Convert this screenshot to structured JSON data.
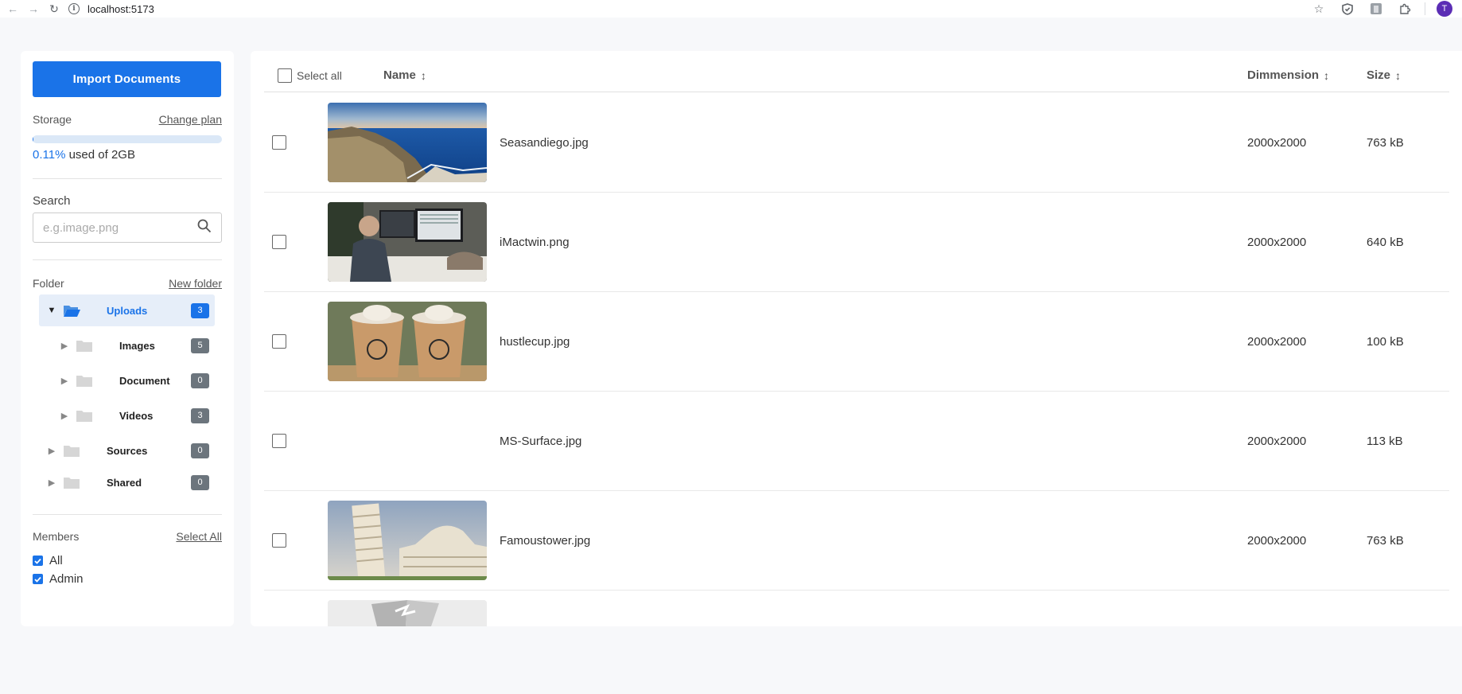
{
  "browser": {
    "url": "localhost:5173",
    "profile_initial": "T"
  },
  "sidebar": {
    "import_label": "Import Documents",
    "storage": {
      "label": "Storage",
      "change_plan": "Change plan",
      "percent_text": "0.11%",
      "percent_value": 0.11,
      "used_of": "used of 2GB"
    },
    "search": {
      "label": "Search",
      "placeholder": "e.g.image.png"
    },
    "folder": {
      "label": "Folder",
      "new_folder": "New folder",
      "items": [
        {
          "name": "Uploads",
          "count": "3",
          "expanded": true,
          "selected": true
        },
        {
          "name": "Images",
          "count": "5"
        },
        {
          "name": "Document",
          "count": "0"
        },
        {
          "name": "Videos",
          "count": "3"
        },
        {
          "name": "Sources",
          "count": "0"
        },
        {
          "name": "Shared",
          "count": "0"
        }
      ]
    },
    "members": {
      "label": "Members",
      "select_all": "Select All",
      "items": [
        {
          "name": "All",
          "checked": true
        },
        {
          "name": "Admin",
          "checked": true
        }
      ]
    }
  },
  "table": {
    "select_all": "Select all",
    "columns": {
      "name": "Name",
      "dimension": "Dimmension",
      "size": "Size",
      "sort_icon": "↕"
    },
    "rows": [
      {
        "name": "Seasandiego.jpg",
        "dimension": "2000x2000",
        "size": "763 kB",
        "thumb": "coast-cliff-ocean"
      },
      {
        "name": "iMactwin.png",
        "dimension": "2000x2000",
        "size": "640 kB",
        "thumb": "person-at-desk-monitors"
      },
      {
        "name": "hustlecup.jpg",
        "dimension": "2000x2000",
        "size": "100 kB",
        "thumb": "iced-coffee-cups"
      },
      {
        "name": "MS-Surface.jpg",
        "dimension": "2000x2000",
        "size": "113 kB",
        "thumb": ""
      },
      {
        "name": "Famoustower.jpg",
        "dimension": "2000x2000",
        "size": "763 kB",
        "thumb": "leaning-tower-pisa"
      },
      {
        "name": "",
        "dimension": "",
        "size": "",
        "thumb": "broken-image-placeholder"
      }
    ]
  },
  "colors": {
    "accent": "#1a73e8",
    "badge_gray": "#6c757d",
    "background": "#f7f8fa"
  }
}
